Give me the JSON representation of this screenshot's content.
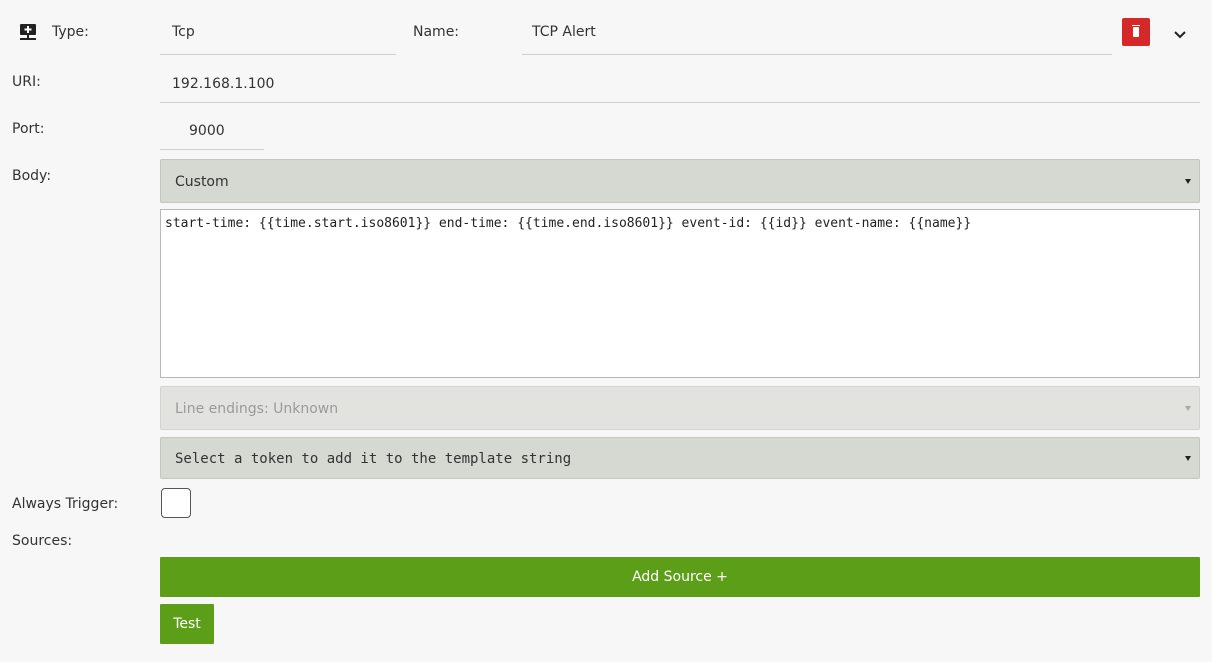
{
  "form": {
    "type_label": "Type:",
    "type_value": "Tcp",
    "name_label": "Name:",
    "name_value": "TCP Alert",
    "uri_label": "URI:",
    "uri_value": "192.168.1.100",
    "port_label": "Port:",
    "port_value": "9000",
    "body_label": "Body:",
    "body_select_value": "Custom",
    "body_template": "start-time: {{time.start.iso8601}} end-time: {{time.end.iso8601}} event-id: {{id}} event-name: {{name}}",
    "line_endings_value": "Line endings: Unknown",
    "token_select_placeholder": "Select a token to add it to the template string",
    "always_trigger_label": "Always Trigger:",
    "always_trigger_checked": false,
    "sources_label": "Sources:",
    "add_source_label": "Add Source +",
    "test_label": "Test"
  },
  "icons": {
    "type_icon": "network-server-icon",
    "delete_icon": "trash-icon",
    "collapse_icon": "chevron-down-icon"
  },
  "colors": {
    "delete": "#d52929",
    "primary_green": "#5d9e18",
    "select_bg": "#d6d8d2"
  }
}
